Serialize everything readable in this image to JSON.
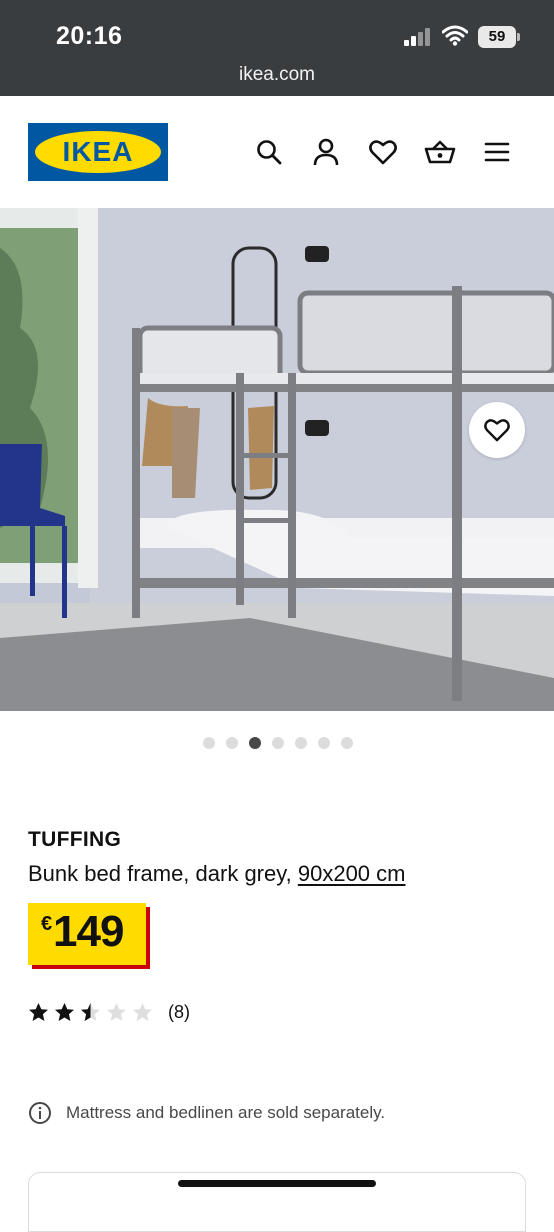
{
  "status_bar": {
    "time": "20:16",
    "battery": "59",
    "url": "ikea.com"
  },
  "header": {
    "logo_text": "IKEA",
    "icons": [
      "search-icon",
      "account-icon",
      "heart-icon",
      "basket-icon",
      "menu-icon"
    ]
  },
  "gallery": {
    "image_count": 7,
    "active_index": 2
  },
  "product": {
    "brand": "TUFFING",
    "description": "Bunk bed frame, dark grey,",
    "size_link": "90x200 cm",
    "price_currency": "€",
    "price_value": "149",
    "rating": 2.5,
    "rating_count": "(8)",
    "note": "Mattress and bedlinen are sold separately."
  },
  "colors": {
    "ikea_blue": "#0058a3",
    "ikea_yellow": "#ffdb00",
    "price_red": "#cc0008",
    "statusbar": "#3a3d3f"
  }
}
